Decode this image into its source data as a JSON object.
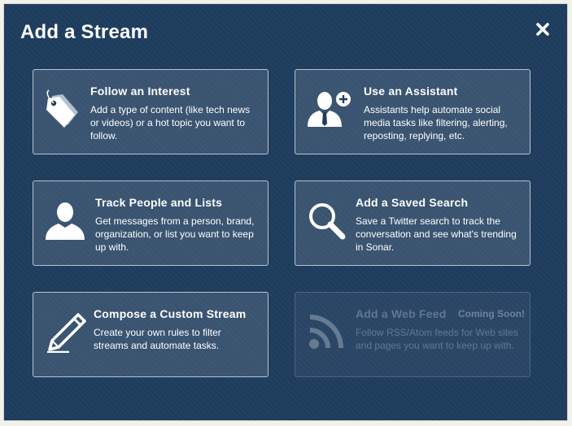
{
  "dialog": {
    "title": "Add a Stream",
    "close_icon": "close-icon"
  },
  "options": [
    {
      "title": "Follow an Interest",
      "description": "Add a type of content (like tech news or videos) or a hot topic you want to follow.",
      "icon": "tags-icon"
    },
    {
      "title": "Use an Assistant",
      "description": "Assistants help automate social media tasks like filtering, alerting, reposting, replying, etc.",
      "icon": "assistant-add-icon"
    },
    {
      "title": "Track People and Lists",
      "description": "Get messages from a person, brand, organization, or list you want to keep up with.",
      "icon": "person-icon"
    },
    {
      "title": "Add a Saved Search",
      "description": "Save a Twitter search to track the conversation and see what's trending in Sonar.",
      "icon": "search-icon"
    },
    {
      "title": "Compose a Custom Stream",
      "description": "Create your own rules to filter streams and automate tasks.",
      "icon": "pencil-icon"
    },
    {
      "title": "Add a Web Feed",
      "badge": "Coming Soon!",
      "description": "Follow RSS/Atom feeds for Web sites and pages you want to keep up with.",
      "icon": "rss-icon",
      "disabled": true
    }
  ],
  "colors": {
    "background": "#1f3d5e",
    "text": "#ffffff"
  }
}
